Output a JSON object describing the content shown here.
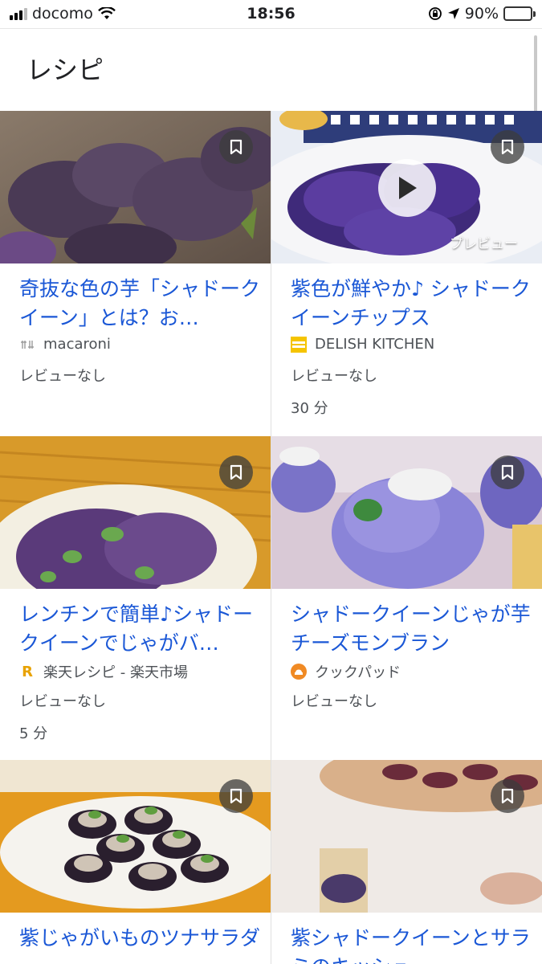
{
  "status_bar": {
    "carrier": "docomo",
    "time": "18:56",
    "battery": "90%"
  },
  "page": {
    "title": "レシピ"
  },
  "recipes": [
    {
      "title": "奇抜な色の芋「シャドークイーン」とは？お…",
      "source": "macaroni",
      "reviews": "レビューなし",
      "time": ""
    },
    {
      "title": "紫色が鮮やか♪ シャドークイーンチップス",
      "source": "DELISH KITCHEN",
      "reviews": "レビューなし",
      "time": "30 分",
      "preview_label": "プレビュー"
    },
    {
      "title": "レンチンで簡単♪シャドークイーンでじゃがバ…",
      "source": "楽天レシピ - 楽天市場",
      "reviews": "レビューなし",
      "time": "5 分"
    },
    {
      "title": "シャドークイーンじゃが芋チーズモンブラン",
      "source": "クックパッド",
      "reviews": "レビューなし",
      "time": ""
    },
    {
      "title": "紫じゃがいものツナサラダ",
      "source": "",
      "reviews": "",
      "time": ""
    },
    {
      "title": "紫シャドークイーンとサラミのキッシュ",
      "source": "",
      "reviews": "",
      "time": ""
    }
  ],
  "colors": {
    "title_link": "#1a57d6",
    "meta_text": "#4d5156",
    "bookmark_bg": "#3c3c3c"
  },
  "icons": {
    "bookmark": "bookmark-icon",
    "play": "play-icon"
  }
}
